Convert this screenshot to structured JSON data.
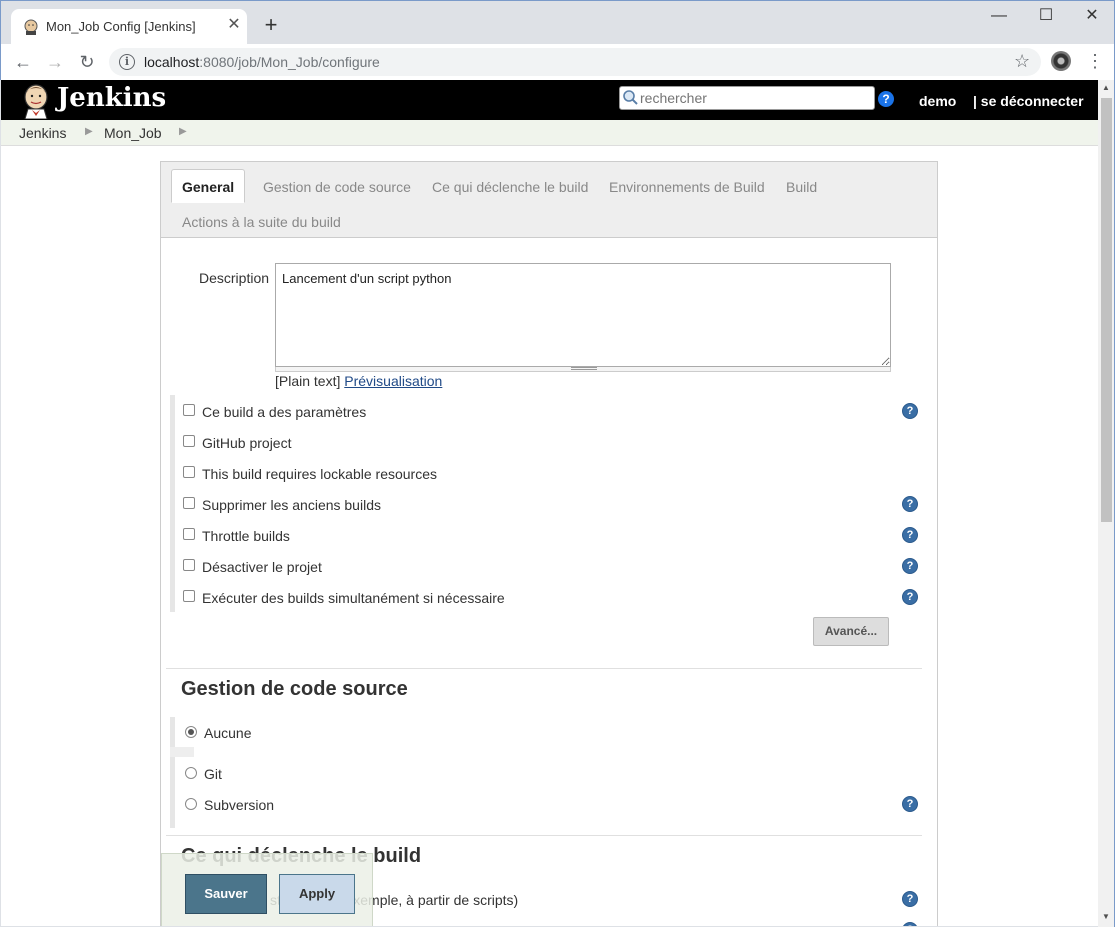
{
  "browser": {
    "tab_title": "Mon_Job Config [Jenkins]",
    "new_tab_label": "+",
    "url_host": "localhost",
    "url_rest": ":8080/job/Mon_Job/configure",
    "window_buttons": {
      "minimize": "—",
      "maximize": "☐",
      "close": "✕"
    }
  },
  "header": {
    "logo_text": "Jenkins",
    "search_placeholder": "rechercher",
    "user": "demo",
    "logout": "| se déconnecter"
  },
  "breadcrumb": [
    "Jenkins",
    "Mon_Job"
  ],
  "tabs": [
    "General",
    "Gestion de code source",
    "Ce qui déclenche le build",
    "Environnements de Build",
    "Build",
    "Actions à la suite du build"
  ],
  "general": {
    "description_label": "Description",
    "description_value": "Lancement d'un script python",
    "plain_text": "[Plain text]",
    "preview_link": "Prévisualisation",
    "options": [
      {
        "label": "Ce build a des paramètres",
        "checked": false,
        "help": true
      },
      {
        "label": "GitHub project",
        "checked": false,
        "help": false
      },
      {
        "label": "This build requires lockable resources",
        "checked": false,
        "help": false
      },
      {
        "label": "Supprimer les anciens builds",
        "checked": false,
        "help": true
      },
      {
        "label": "Throttle builds",
        "checked": false,
        "help": true
      },
      {
        "label": "Désactiver le projet",
        "checked": false,
        "help": true
      },
      {
        "label": "Exécuter des builds simultanément si nécessaire",
        "checked": false,
        "help": true
      }
    ],
    "advanced_button": "Avancé..."
  },
  "scm": {
    "title": "Gestion de code source",
    "options": [
      {
        "label": "Aucune",
        "selected": true
      },
      {
        "label": "Git",
        "selected": false
      },
      {
        "label": "Subversion",
        "selected": false
      }
    ]
  },
  "triggers": {
    "title": "Ce qui déclenche le build",
    "first_option_visible_text": "stance (Par exemple, à partir de scripts)"
  },
  "footer": {
    "save": "Sauver",
    "apply": "Apply"
  },
  "colors": {
    "header_bg": "#000000",
    "save_button": "#4b758b",
    "apply_button": "#c9d9ea",
    "help_icon": "#3a6ea5"
  }
}
